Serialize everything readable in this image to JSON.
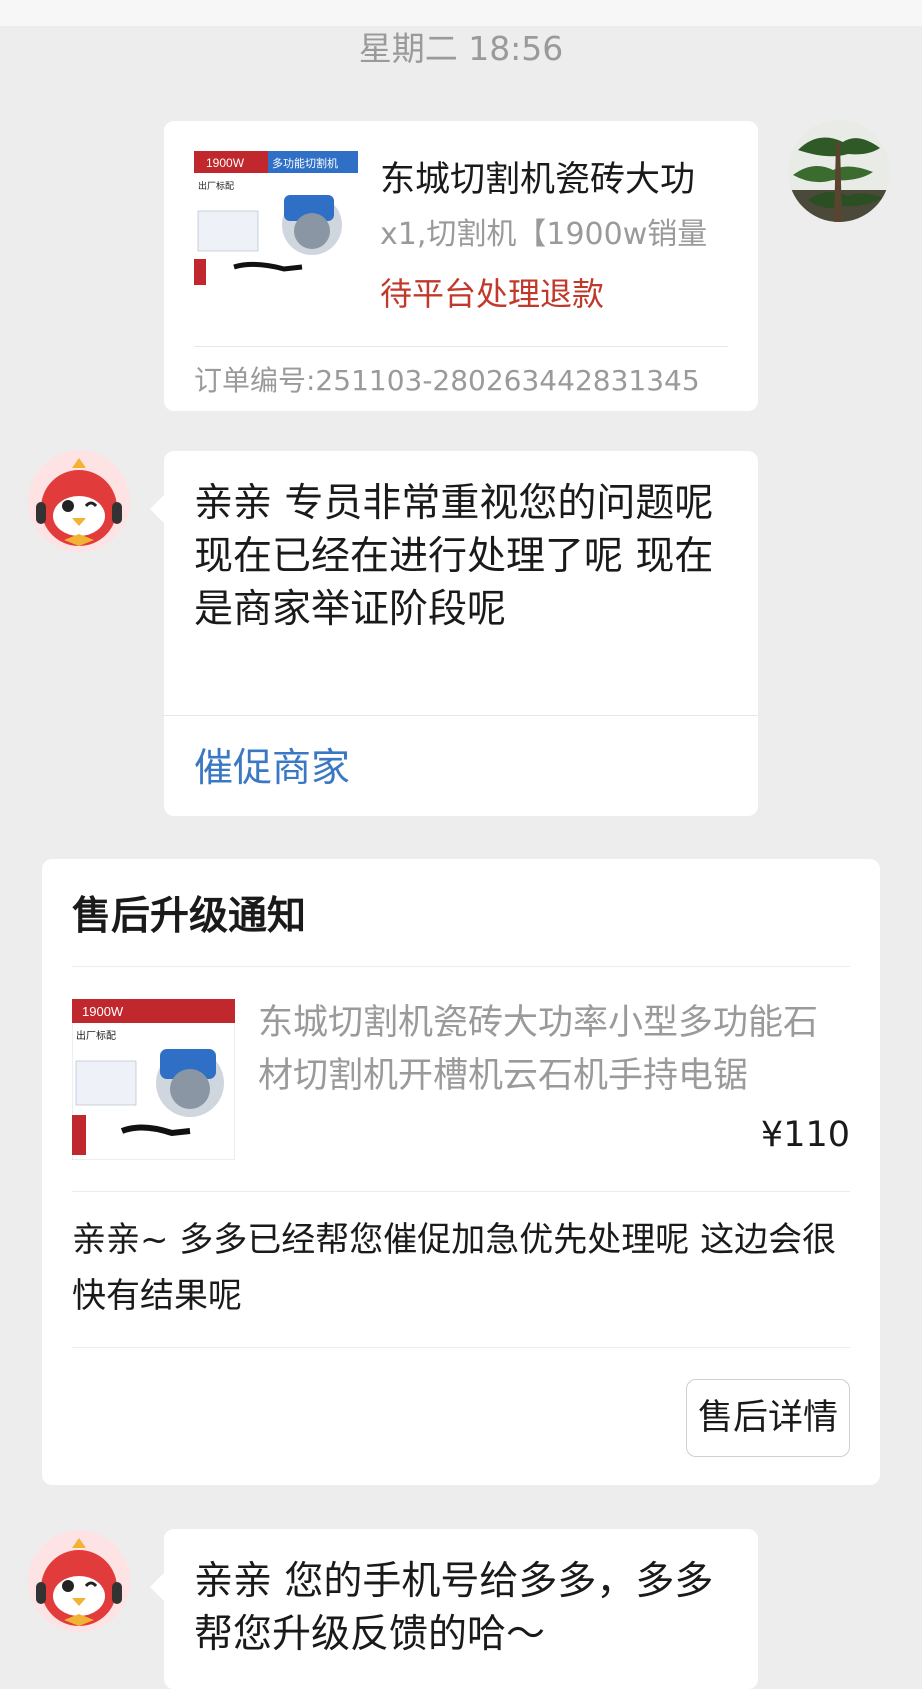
{
  "timestamp": "星期二 18:56",
  "order": {
    "title": "东城切割机瓷砖大功",
    "spec": "x1,切割机【1900w销量",
    "status": "待平台处理退款",
    "order_no": "订单编号:251103-280263442831345",
    "thumb_badge": "1900W",
    "thumb_banner": "多功能切割机",
    "thumb_label": "出厂标配"
  },
  "messages": [
    {
      "text": "亲亲 专员非常重视您的问题呢 现在已经在进行处理了呢 现在是商家举证阶段呢",
      "action": "催促商家"
    },
    {
      "text": "亲亲 您的手机号给多多，多多帮您升级反馈的哈～"
    }
  ],
  "after_sales": {
    "title": "售后升级通知",
    "product_title": "东城切割机瓷砖大功率小型多功能石材切割机开槽机云石机手持电锯",
    "price": "¥110",
    "message": "亲亲~ 多多已经帮您催促加急优先处理呢   这边会很快有结果呢",
    "button": "售后详情",
    "thumb_badge": "1900W",
    "thumb_label": "出厂标配"
  },
  "colors": {
    "background": "#ededed",
    "status_red": "#c0392b",
    "action_blue": "#3b78c4",
    "muted": "#9a9a9a"
  },
  "icons": [
    "user-avatar-pine",
    "service-bot-avatar"
  ]
}
